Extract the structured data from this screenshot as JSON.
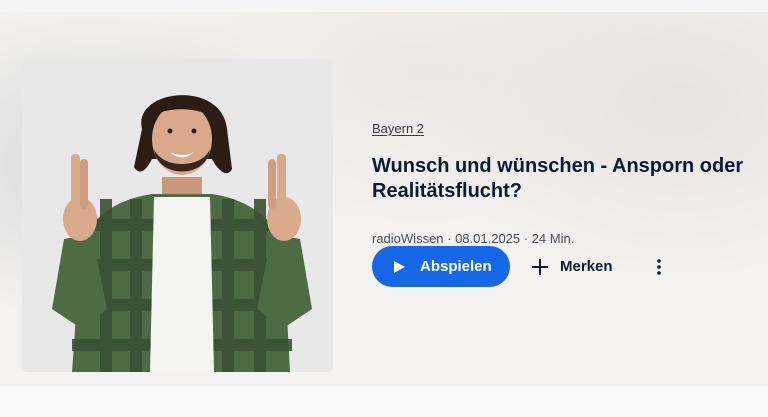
{
  "episode": {
    "broadcaster": "Bayern 2",
    "title": "Wunsch und wünschen - Ansporn oder Realitätsflucht?",
    "meta": "radioWissen · 08.01.2025 · 24 Min.",
    "cover_alt": "Mann mit gekreuzten Fingern"
  },
  "actions": {
    "play_label": "Abspielen",
    "save_label": "Merken",
    "more_icon": "more-vertical-icon",
    "play_icon": "play-icon",
    "add_icon": "plus-icon"
  },
  "colors": {
    "primary": "#1567e8",
    "title": "#0d1a35",
    "meta": "#4b4f58"
  }
}
